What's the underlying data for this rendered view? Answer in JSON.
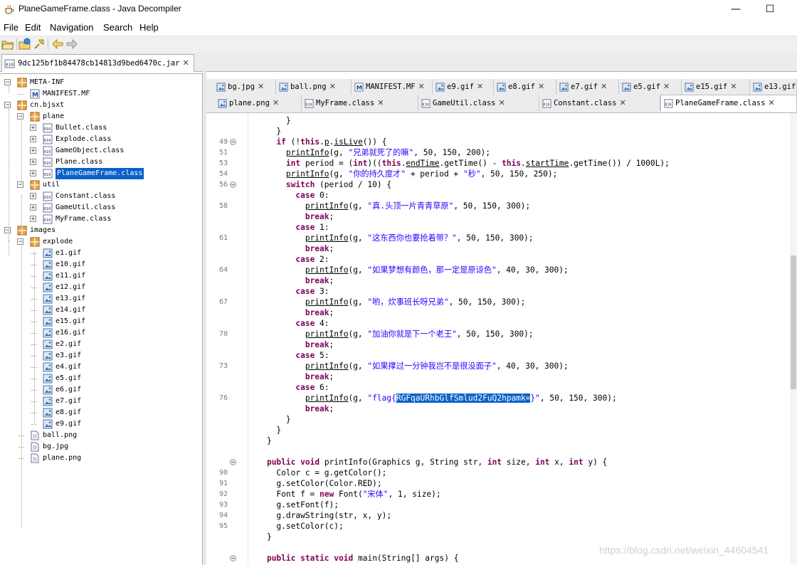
{
  "window": {
    "title": "PlaneGameFrame.class - Java Decompiler",
    "minimize": "—",
    "maximize": "☐"
  },
  "menu": {
    "items": [
      "File",
      "Edit",
      "Navigation",
      "Search",
      "Help"
    ]
  },
  "toolbar": {
    "icons": [
      "open-file-icon",
      "open-type-icon",
      "search-icon",
      "back-arrow-icon",
      "forward-arrow-icon"
    ]
  },
  "outer_tab": {
    "label": "9dc125bf1b84478cb14813d9bed6470c.jar"
  },
  "tree": [
    {
      "label": "META-INF",
      "kind": "package",
      "exp": "−"
    },
    {
      "label": "MANIFEST.MF",
      "kind": "manifest"
    },
    {
      "label": "cn.bjsxt",
      "kind": "package",
      "exp": "−"
    },
    {
      "label": "plane",
      "kind": "package",
      "exp": "−"
    },
    {
      "label": "Bullet.class",
      "kind": "class",
      "exp": "+"
    },
    {
      "label": "Explode.class",
      "kind": "class",
      "exp": "+"
    },
    {
      "label": "GameObject.class",
      "kind": "class",
      "exp": "+"
    },
    {
      "label": "Plane.class",
      "kind": "class",
      "exp": "+"
    },
    {
      "label": "PlaneGameFrame.class",
      "kind": "class",
      "exp": "+",
      "selected": true
    },
    {
      "label": "util",
      "kind": "package",
      "exp": "−"
    },
    {
      "label": "Constant.class",
      "kind": "class",
      "exp": "+"
    },
    {
      "label": "GameUtil.class",
      "kind": "class",
      "exp": "+"
    },
    {
      "label": "MyFrame.class",
      "kind": "class",
      "exp": "+"
    },
    {
      "label": "images",
      "kind": "package",
      "exp": "−"
    },
    {
      "label": "explode",
      "kind": "package",
      "exp": "−"
    },
    {
      "label": "e1.gif",
      "kind": "image"
    },
    {
      "label": "e10.gif",
      "kind": "image"
    },
    {
      "label": "e11.gif",
      "kind": "image"
    },
    {
      "label": "e12.gif",
      "kind": "image"
    },
    {
      "label": "e13.gif",
      "kind": "image"
    },
    {
      "label": "e14.gif",
      "kind": "image"
    },
    {
      "label": "e15.gif",
      "kind": "image"
    },
    {
      "label": "e16.gif",
      "kind": "image"
    },
    {
      "label": "e2.gif",
      "kind": "image"
    },
    {
      "label": "e3.gif",
      "kind": "image"
    },
    {
      "label": "e4.gif",
      "kind": "image"
    },
    {
      "label": "e5.gif",
      "kind": "image"
    },
    {
      "label": "e6.gif",
      "kind": "image"
    },
    {
      "label": "e7.gif",
      "kind": "image"
    },
    {
      "label": "e8.gif",
      "kind": "image"
    },
    {
      "label": "e9.gif",
      "kind": "image"
    },
    {
      "label": "ball.png",
      "kind": "file"
    },
    {
      "label": "bg.jpg",
      "kind": "file"
    },
    {
      "label": "plane.png",
      "kind": "file"
    }
  ],
  "tabs_row1": [
    {
      "label": "bg.jpg",
      "kind": "image"
    },
    {
      "label": "ball.png",
      "kind": "image"
    },
    {
      "label": "MANIFEST.MF",
      "kind": "manifest"
    },
    {
      "label": "e9.gif",
      "kind": "image"
    },
    {
      "label": "e8.gif",
      "kind": "image"
    },
    {
      "label": "e7.gif",
      "kind": "image"
    },
    {
      "label": "e5.gif",
      "kind": "image"
    },
    {
      "label": "e15.gif",
      "kind": "image"
    },
    {
      "label": "e13.gif",
      "kind": "image"
    }
  ],
  "tabs_row2": [
    {
      "label": "plane.png",
      "kind": "image"
    },
    {
      "label": "MyFrame.class",
      "kind": "class"
    },
    {
      "label": "GameUtil.class",
      "kind": "class"
    },
    {
      "label": "Constant.class",
      "kind": "class"
    },
    {
      "label": "PlaneGameFrame.class",
      "kind": "class",
      "active": true
    }
  ],
  "code": [
    {
      "ln": "",
      "t": [
        [
          "p",
          "        }"
        ]
      ]
    },
    {
      "ln": "",
      "t": [
        [
          "p",
          "      }"
        ]
      ]
    },
    {
      "ln": "49",
      "fold": "−",
      "t": [
        [
          "p",
          "      "
        ],
        [
          "k",
          "if"
        ],
        [
          "p",
          " (!"
        ],
        [
          "k",
          "this"
        ],
        [
          "p",
          "."
        ],
        [
          "u",
          "p"
        ],
        [
          "p",
          "."
        ],
        [
          "u",
          "isLive"
        ],
        [
          "p",
          "()) {"
        ]
      ]
    },
    {
      "ln": "51",
      "t": [
        [
          "p",
          "        "
        ],
        [
          "u",
          "printInfo"
        ],
        [
          "p",
          "(g, "
        ],
        [
          "s",
          "\"兄弟就死了的嘛\""
        ],
        [
          "p",
          ", 50, 150, 200);"
        ]
      ]
    },
    {
      "ln": "53",
      "t": [
        [
          "p",
          "        "
        ],
        [
          "k",
          "int"
        ],
        [
          "p",
          " period = ("
        ],
        [
          "k",
          "int"
        ],
        [
          "p",
          ")(("
        ],
        [
          "k",
          "this"
        ],
        [
          "p",
          "."
        ],
        [
          "u",
          "endTime"
        ],
        [
          "p",
          ".getTime() - "
        ],
        [
          "k",
          "this"
        ],
        [
          "p",
          "."
        ],
        [
          "u",
          "startTime"
        ],
        [
          "p",
          ".getTime()) / 1000L);"
        ]
      ]
    },
    {
      "ln": "54",
      "t": [
        [
          "p",
          "        "
        ],
        [
          "u",
          "printInfo"
        ],
        [
          "p",
          "(g, "
        ],
        [
          "s",
          "\"你的持久度才\""
        ],
        [
          "p",
          " + period + "
        ],
        [
          "s",
          "\"秒\""
        ],
        [
          "p",
          ", 50, 150, 250);"
        ]
      ]
    },
    {
      "ln": "56",
      "fold": "−",
      "t": [
        [
          "p",
          "        "
        ],
        [
          "k",
          "switch"
        ],
        [
          "p",
          " (period / 10) {"
        ]
      ]
    },
    {
      "ln": "",
      "t": [
        [
          "p",
          "          "
        ],
        [
          "k",
          "case"
        ],
        [
          "p",
          " 0:"
        ]
      ]
    },
    {
      "ln": "58",
      "t": [
        [
          "p",
          "            "
        ],
        [
          "u",
          "printInfo"
        ],
        [
          "p",
          "(g, "
        ],
        [
          "s",
          "\"真.头顶一片青青草原\""
        ],
        [
          "p",
          ", 50, 150, 300);"
        ]
      ]
    },
    {
      "ln": "",
      "t": [
        [
          "p",
          "            "
        ],
        [
          "k",
          "break"
        ],
        [
          "p",
          ";"
        ]
      ]
    },
    {
      "ln": "",
      "t": [
        [
          "p",
          "          "
        ],
        [
          "k",
          "case"
        ],
        [
          "p",
          " 1:"
        ]
      ]
    },
    {
      "ln": "61",
      "t": [
        [
          "p",
          "            "
        ],
        [
          "u",
          "printInfo"
        ],
        [
          "p",
          "(g, "
        ],
        [
          "s",
          "\"这东西你也要抢着带？\""
        ],
        [
          "p",
          ", 50, 150, 300);"
        ]
      ]
    },
    {
      "ln": "",
      "t": [
        [
          "p",
          "            "
        ],
        [
          "k",
          "break"
        ],
        [
          "p",
          ";"
        ]
      ]
    },
    {
      "ln": "",
      "t": [
        [
          "p",
          "          "
        ],
        [
          "k",
          "case"
        ],
        [
          "p",
          " 2:"
        ]
      ]
    },
    {
      "ln": "64",
      "t": [
        [
          "p",
          "            "
        ],
        [
          "u",
          "printInfo"
        ],
        [
          "p",
          "(g, "
        ],
        [
          "s",
          "\"如果梦想有颜色，那一定是原谅色\""
        ],
        [
          "p",
          ", 40, 30, 300);"
        ]
      ]
    },
    {
      "ln": "",
      "t": [
        [
          "p",
          "            "
        ],
        [
          "k",
          "break"
        ],
        [
          "p",
          ";"
        ]
      ]
    },
    {
      "ln": "",
      "t": [
        [
          "p",
          "          "
        ],
        [
          "k",
          "case"
        ],
        [
          "p",
          " 3:"
        ]
      ]
    },
    {
      "ln": "67",
      "t": [
        [
          "p",
          "            "
        ],
        [
          "u",
          "printInfo"
        ],
        [
          "p",
          "(g, "
        ],
        [
          "s",
          "\"哟，炊事班长呀兄弟\""
        ],
        [
          "p",
          ", 50, 150, 300);"
        ]
      ]
    },
    {
      "ln": "",
      "t": [
        [
          "p",
          "            "
        ],
        [
          "k",
          "break"
        ],
        [
          "p",
          ";"
        ]
      ]
    },
    {
      "ln": "",
      "t": [
        [
          "p",
          "          "
        ],
        [
          "k",
          "case"
        ],
        [
          "p",
          " 4:"
        ]
      ]
    },
    {
      "ln": "70",
      "t": [
        [
          "p",
          "            "
        ],
        [
          "u",
          "printInfo"
        ],
        [
          "p",
          "(g, "
        ],
        [
          "s",
          "\"加油你就是下一个老王\""
        ],
        [
          "p",
          ", 50, 150, 300);"
        ]
      ]
    },
    {
      "ln": "",
      "t": [
        [
          "p",
          "            "
        ],
        [
          "k",
          "break"
        ],
        [
          "p",
          ";"
        ]
      ]
    },
    {
      "ln": "",
      "t": [
        [
          "p",
          "          "
        ],
        [
          "k",
          "case"
        ],
        [
          "p",
          " 5:"
        ]
      ]
    },
    {
      "ln": "73",
      "t": [
        [
          "p",
          "            "
        ],
        [
          "u",
          "printInfo"
        ],
        [
          "p",
          "(g, "
        ],
        [
          "s",
          "\"如果撑过一分钟我岂不是很没面子\""
        ],
        [
          "p",
          ", 40, 30, 300);"
        ]
      ]
    },
    {
      "ln": "",
      "t": [
        [
          "p",
          "            "
        ],
        [
          "k",
          "break"
        ],
        [
          "p",
          ";"
        ]
      ]
    },
    {
      "ln": "",
      "t": [
        [
          "p",
          "          "
        ],
        [
          "k",
          "case"
        ],
        [
          "p",
          " 6:"
        ]
      ]
    },
    {
      "ln": "76",
      "t": [
        [
          "p",
          "            "
        ],
        [
          "u",
          "printInfo"
        ],
        [
          "p",
          "(g, "
        ],
        [
          "s",
          "\"flag{"
        ],
        [
          "h",
          "RGFqaURhbGlfSmlud2FuQ2hpamk="
        ],
        [
          "s",
          "}\""
        ],
        [
          "p",
          ", 50, 150, 300);"
        ]
      ]
    },
    {
      "ln": "",
      "t": [
        [
          "p",
          "            "
        ],
        [
          "k",
          "break"
        ],
        [
          "p",
          ";"
        ]
      ]
    },
    {
      "ln": "",
      "t": [
        [
          "p",
          "        }"
        ]
      ]
    },
    {
      "ln": "",
      "t": [
        [
          "p",
          "      }"
        ]
      ]
    },
    {
      "ln": "",
      "t": [
        [
          "p",
          "    }"
        ]
      ]
    },
    {
      "ln": "",
      "t": [
        [
          "p",
          ""
        ]
      ]
    },
    {
      "ln": "",
      "fold": "−",
      "t": [
        [
          "p",
          "    "
        ],
        [
          "k",
          "public"
        ],
        [
          "p",
          " "
        ],
        [
          "k",
          "void"
        ],
        [
          "p",
          " printInfo(Graphics g, String str, "
        ],
        [
          "k",
          "int"
        ],
        [
          "p",
          " size, "
        ],
        [
          "k",
          "int"
        ],
        [
          "p",
          " x, "
        ],
        [
          "k",
          "int"
        ],
        [
          "p",
          " y) {"
        ]
      ]
    },
    {
      "ln": "90",
      "t": [
        [
          "p",
          "      Color c = g.getColor();"
        ]
      ]
    },
    {
      "ln": "91",
      "t": [
        [
          "p",
          "      g.setColor(Color.RED);"
        ]
      ]
    },
    {
      "ln": "92",
      "t": [
        [
          "p",
          "      Font f = "
        ],
        [
          "k",
          "new"
        ],
        [
          "p",
          " Font("
        ],
        [
          "s",
          "\"宋体\""
        ],
        [
          "p",
          ", 1, size);"
        ]
      ]
    },
    {
      "ln": "93",
      "t": [
        [
          "p",
          "      g.setFont(f);"
        ]
      ]
    },
    {
      "ln": "94",
      "t": [
        [
          "p",
          "      g.drawString(str, x, y);"
        ]
      ]
    },
    {
      "ln": "95",
      "t": [
        [
          "p",
          "      g.setColor(c);"
        ]
      ]
    },
    {
      "ln": "",
      "t": [
        [
          "p",
          "    }"
        ]
      ]
    },
    {
      "ln": "",
      "t": [
        [
          "p",
          ""
        ]
      ]
    },
    {
      "ln": "",
      "fold": "−",
      "t": [
        [
          "p",
          "    "
        ],
        [
          "k",
          "public"
        ],
        [
          "p",
          " "
        ],
        [
          "k",
          "static"
        ],
        [
          "p",
          " "
        ],
        [
          "k",
          "void"
        ],
        [
          "p",
          " main(String[] args) {"
        ]
      ]
    }
  ],
  "watermark": "https://blog.csdn.net/weixin_44604541",
  "colors": {
    "keyword": "#7f0055",
    "string": "#2a00ff",
    "selection": "#0a61c9"
  }
}
